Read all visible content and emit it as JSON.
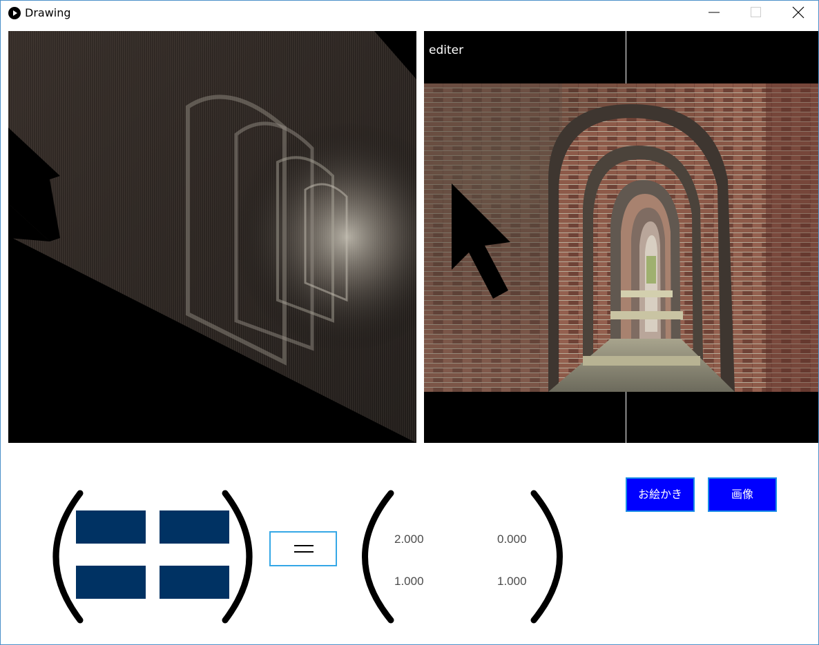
{
  "window": {
    "title": "Drawing",
    "controls": {
      "minimize": "minimize-icon",
      "maximize": "maximize-icon",
      "close": "close-icon"
    }
  },
  "right_panel": {
    "label": "editer"
  },
  "matrix_left": {
    "cells": [
      "",
      "",
      "",
      ""
    ],
    "cell_color": "#003263"
  },
  "equals": {
    "symbol": "="
  },
  "matrix_right": {
    "values": [
      "2.000",
      "0.000",
      "1.000",
      "1.000"
    ]
  },
  "buttons": {
    "draw_label": "お絵かき",
    "image_label": "画像",
    "color": "#0000ff"
  }
}
